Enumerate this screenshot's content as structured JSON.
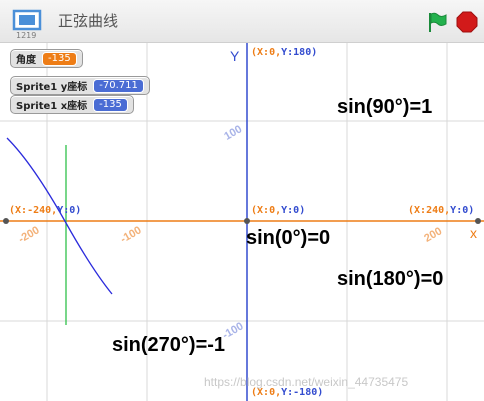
{
  "titlebar": {
    "title": "正弦曲线",
    "stage_number": "1219",
    "icons": {
      "stage": "stage-layout-icon",
      "flag": "green-flag-icon",
      "stop": "stop-sign-icon"
    },
    "colors": {
      "flag": "#23b14d",
      "stop": "#d21a1a"
    }
  },
  "monitors": {
    "angle": {
      "label": "角度",
      "value": "-135"
    },
    "sprite_y": {
      "label": "Sprite1 y座标",
      "value": "-70.711"
    },
    "sprite_x": {
      "label": "Sprite1 x座标",
      "value": "-135"
    }
  },
  "grid": {
    "axis_x_label": "x",
    "axis_y_label": "Y",
    "ticks": {
      "x_neg200": "-200",
      "x_neg100": "-100",
      "x_200": "200",
      "y_100": "100",
      "y_neg100": "-100"
    },
    "coords": {
      "top": {
        "x": "X:0",
        "y": "Y:180"
      },
      "center": {
        "x": "X:0",
        "y": "Y:0"
      },
      "left": {
        "x": "X:-240",
        "y": "Y:0"
      },
      "right": {
        "x": "X:240",
        "y": "Y:0"
      },
      "bottom": {
        "x": "X:0",
        "y": "Y:-180"
      }
    }
  },
  "annotations": {
    "sin90": "sin(90°)=1",
    "sin0": "sin(0°)=0",
    "sin180": "sin(180°)=0",
    "sin270": "sin(270°)=-1"
  },
  "watermark": "https://blog.csdn.net/weixin_44735475",
  "colors": {
    "x_axis": "#ee7d16",
    "y_axis": "#334ccf",
    "curve": "#2b2bdc",
    "marker": "#2fc14a",
    "grid": "#d9d9d9"
  }
}
